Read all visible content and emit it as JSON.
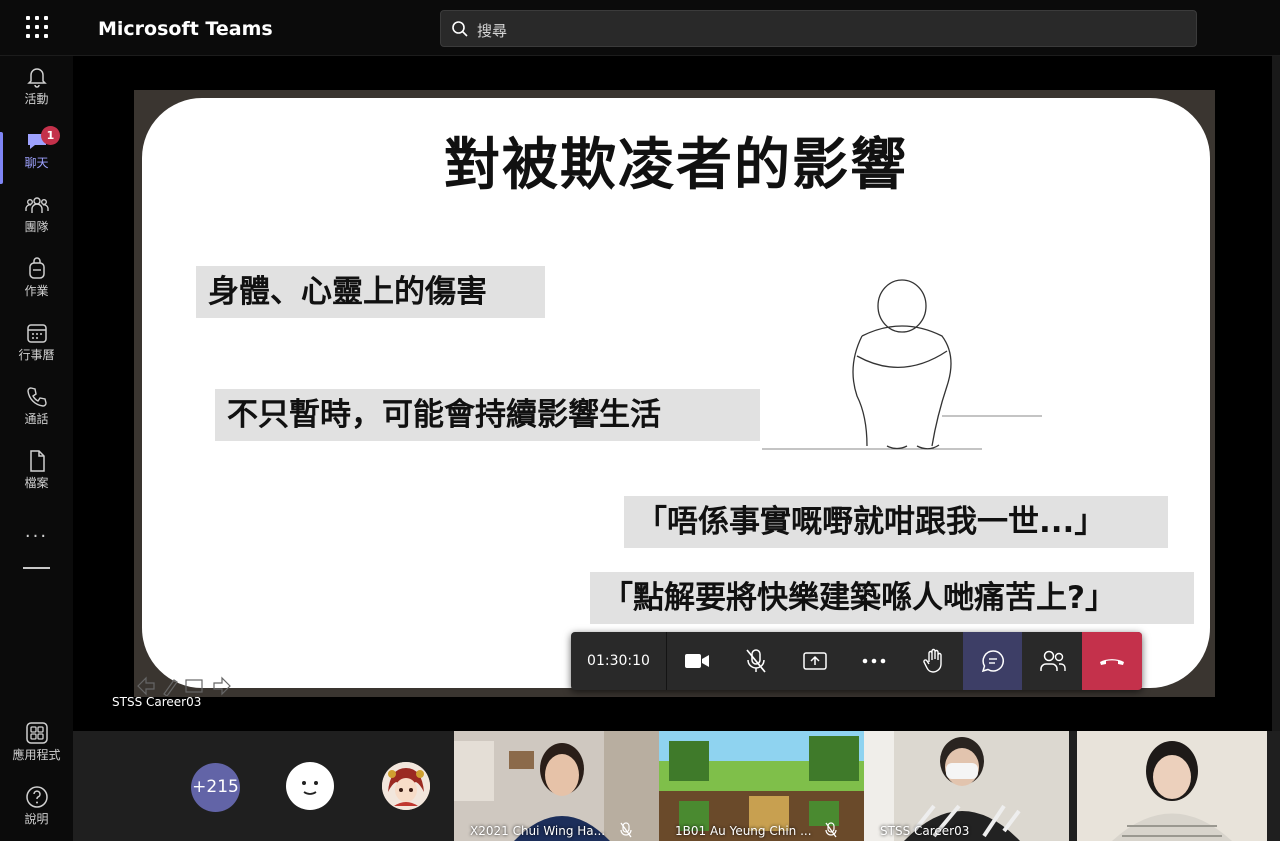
{
  "app": {
    "title": "Microsoft Teams"
  },
  "search": {
    "placeholder": "搜尋"
  },
  "rail": {
    "items": [
      {
        "label": "活動",
        "icon": "bell-icon"
      },
      {
        "label": "聊天",
        "icon": "chat-icon",
        "badge": "1"
      },
      {
        "label": "團隊",
        "icon": "teams-icon"
      },
      {
        "label": "作業",
        "icon": "assignments-icon"
      },
      {
        "label": "行事曆",
        "icon": "calendar-icon"
      },
      {
        "label": "通話",
        "icon": "phone-icon"
      },
      {
        "label": "檔案",
        "icon": "file-icon"
      }
    ],
    "more": "···",
    "apps_label": "應用程式",
    "help_label": "說明"
  },
  "slide": {
    "title": "對被欺凌者的影響",
    "point1": "身體、心靈上的傷害",
    "point2": "不只暫時，可能會持續影響生活",
    "quote1": "「唔係事實嘅嘢就咁跟我一世...」",
    "quote2": "「點解要將快樂建築喺人哋痛苦上?」"
  },
  "presenter": {
    "name": "STSS Career03"
  },
  "callbar": {
    "timer": "01:30:10"
  },
  "filmstrip": {
    "overflow_count": "+215",
    "tiles": [
      {
        "name": "X2021 Chui Wing Ha..."
      },
      {
        "name": "1B01 Au Yeung Chin ..."
      },
      {
        "name": "STSS Career03"
      },
      {
        "name": ""
      }
    ]
  },
  "colors": {
    "accent": "#6264a7",
    "hangup": "#c4314b",
    "active_rail": "#7f85f5"
  }
}
